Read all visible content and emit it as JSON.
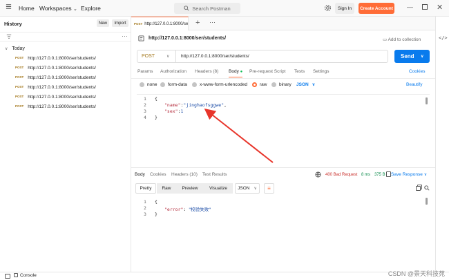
{
  "topbar": {
    "home": "Home",
    "workspaces": "Workspaces",
    "explore": "Explore",
    "search_placeholder": "Search Postman",
    "sign_in": "Sign In",
    "create_account": "Create Account"
  },
  "sidebar": {
    "title": "History",
    "new_label": "New",
    "import_label": "Import",
    "group": "Today",
    "items": [
      {
        "method": "POST",
        "url": "http://127.0.0.1:8000/ser/students/"
      },
      {
        "method": "POST",
        "url": "http://127.0.0.1:8000/ser/students/"
      },
      {
        "method": "POST",
        "url": "http://127.0.0.1:8000/ser/students/"
      },
      {
        "method": "POST",
        "url": "http://127.0.0.1:8000/ser/students/"
      },
      {
        "method": "POST",
        "url": "http://127.0.0.1:8000/ser/students/"
      },
      {
        "method": "POST",
        "url": "http://127.0.0.1:8000/ser/students/"
      }
    ]
  },
  "tab": {
    "method": "POST",
    "label": "http://127.0.0.1:8000/se"
  },
  "request": {
    "title": "http://127.0.0.1:8000/ser/students/",
    "add_to_collection": "Add to collection",
    "method": "POST",
    "url": "http://127.0.0.1:8000/ser/students/",
    "send": "Send",
    "tabs": {
      "params": "Params",
      "auth": "Authorization",
      "headers": "Headers (8)",
      "body": "Body",
      "prerequest": "Pre-request Script",
      "tests": "Tests",
      "settings": "Settings",
      "cookies": "Cookies"
    },
    "body_types": {
      "none": "none",
      "form_data": "form-data",
      "urlencoded": "x-www-form-urlencoded",
      "raw": "raw",
      "binary": "binary",
      "json": "JSON",
      "beautify": "Beautify"
    },
    "lines": [
      "1",
      "2",
      "3",
      "4"
    ],
    "code": {
      "open": "{",
      "k1": "\"name\"",
      "v1": "\"jinghaofsggwe\"",
      "k2": "\"sex\"",
      "v2": "1",
      "close": "}"
    }
  },
  "response": {
    "tabs": {
      "body": "Body",
      "cookies": "Cookies",
      "headers": "Headers (10)",
      "tests": "Test Results"
    },
    "status": "400 Bad Request",
    "time": "8 ms",
    "size": "375 B",
    "save": "Save Response",
    "formats": {
      "pretty": "Pretty",
      "raw": "Raw",
      "preview": "Preview",
      "visualize": "Visualize",
      "json": "JSON"
    },
    "lines": [
      "1",
      "2",
      "3"
    ],
    "code": {
      "open": "{",
      "k1": "\"error\"",
      "v1": "\"校验失败\"",
      "close": "}"
    }
  },
  "bottom": {
    "console": "Console"
  },
  "watermark": "CSDN @景天科技苑",
  "colors": {
    "accent": "#ff6c37",
    "send": "#097bed",
    "method": "#a27518",
    "status_error": "#c9302c"
  }
}
